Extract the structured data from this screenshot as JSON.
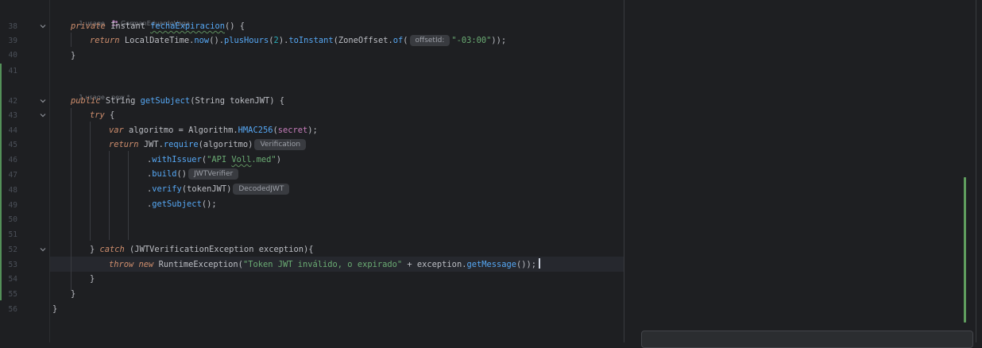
{
  "hints": {
    "h1_usage": "1 usage",
    "h1_author": "GermanEduardoVega",
    "h2_usage": "1 usage",
    "h2_new": "new *"
  },
  "line_numbers": [
    "38",
    "39",
    "40",
    "41",
    "42",
    "43",
    "44",
    "45",
    "46",
    "47",
    "48",
    "49",
    "50",
    "51",
    "52",
    "53",
    "54",
    "55",
    "56"
  ],
  "code": {
    "l38": {
      "kw": "private",
      "type": "Instant",
      "fn": "fechaExpiracion",
      "rest": "() {"
    },
    "l39": {
      "kw": "return",
      "a": "LocalDateTime.",
      "fn1": "now",
      "b": "().",
      "fn2": "plusHours",
      "c": "(",
      "num": "2",
      "d": ").",
      "fn3": "toInstant",
      "e": "(ZoneOffset.",
      "fn4": "of",
      "f": "(",
      "param": "offsetId:",
      "str": "\"-03:00\"",
      "g": "));"
    },
    "l40": "}",
    "l42": {
      "kw": "public",
      "type": "String",
      "fn": "getSubject",
      "rest": "(String tokenJWT) {"
    },
    "l43": {
      "kw": "try",
      "rest": " {"
    },
    "l44": {
      "kw": "var",
      "a": " algoritmo = Algorithm.",
      "fn": "HMAC256",
      "b": "(",
      "fld": "secret",
      "c": ");"
    },
    "l45": {
      "kw": "return",
      "a": " JWT.",
      "fn": "require",
      "b": "(algoritmo)",
      "hint": "Verification"
    },
    "l46": {
      "a": ".",
      "fn": "withIssuer",
      "b": "(",
      "str1": "\"API ",
      "str2": "Voll",
      "str3": ".med\"",
      "c": ")"
    },
    "l47": {
      "a": ".",
      "fn": "build",
      "b": "()",
      "hint": "JWTVerifier"
    },
    "l48": {
      "a": ".",
      "fn": "verify",
      "b": "(tokenJWT)",
      "hint": "DecodedJWT"
    },
    "l49": {
      "a": ".",
      "fn": "getSubject",
      "b": "();"
    },
    "l52": {
      "a": "} ",
      "kw": "catch",
      "b": " (JWTVerificationException exception){"
    },
    "l53": {
      "kw1": "throw",
      "kw2": "new",
      "a": " RuntimeException(",
      "str": "\"Token JWT inválido, o expirado\"",
      "b": " + exception.",
      "fn": "getMessage",
      "c": "());"
    },
    "l54": "}",
    "l55": "}",
    "l56": "}"
  },
  "colors": {
    "background": "#1e1f22",
    "keyword": "#cf8e6d",
    "function": "#56a8f5",
    "string": "#6aab73",
    "number": "#2aacb8",
    "field": "#c77dbb",
    "vcs_added": "#549159"
  }
}
